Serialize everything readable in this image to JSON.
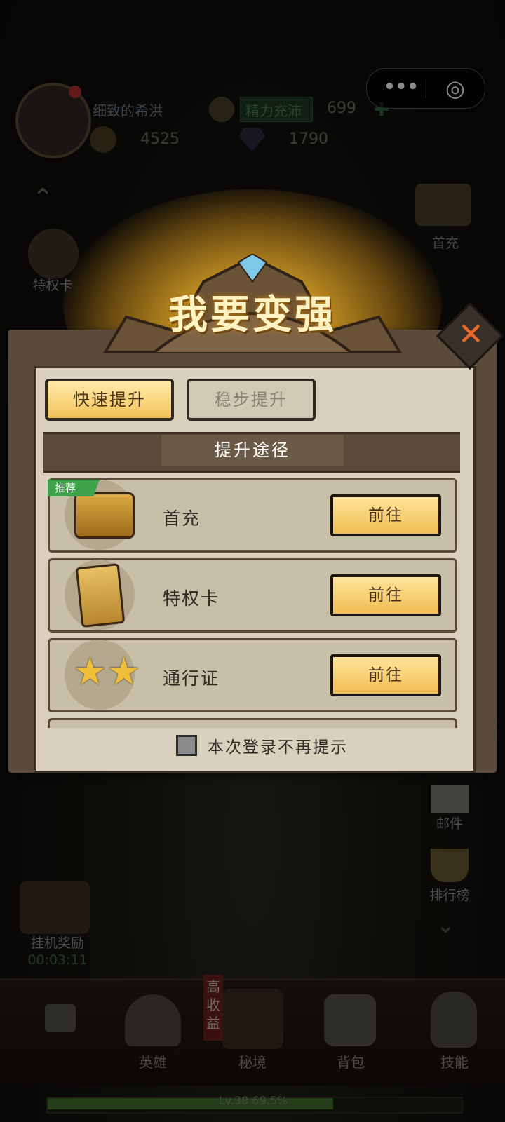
{
  "player": {
    "name": "细致的希洪",
    "gold": "4525",
    "gems": "1790",
    "energy_label": "精力充沛",
    "energy_value": "699"
  },
  "side_left": {
    "privilege": "特权卡"
  },
  "side_right": {
    "first_recharge": "首充",
    "mail": "邮件",
    "rank": "排行榜"
  },
  "idle": {
    "label": "挂机奖励",
    "timer": "00:03:11"
  },
  "dialog": {
    "title": "我要变强",
    "tabs": [
      {
        "label": "快速提升"
      },
      {
        "label": "稳步提升"
      }
    ],
    "section": "提升途径",
    "badge": "推荐",
    "rows": [
      {
        "label": "首充",
        "button": "前往"
      },
      {
        "label": "特权卡",
        "button": "前往"
      },
      {
        "label": "通行证",
        "button": "前往"
      }
    ],
    "dont_show": "本次登录不再提示",
    "close": "✕"
  },
  "nav": [
    {
      "label": ""
    },
    {
      "label": "英雄"
    },
    {
      "label": "秘境"
    },
    {
      "label": "背包"
    },
    {
      "label": "技能"
    }
  ],
  "nav_badge": "高收益",
  "level": {
    "text": "Lv.38  69.5%",
    "progress": 0.695
  },
  "capsule": {
    "more": "•••",
    "target": "◎"
  }
}
